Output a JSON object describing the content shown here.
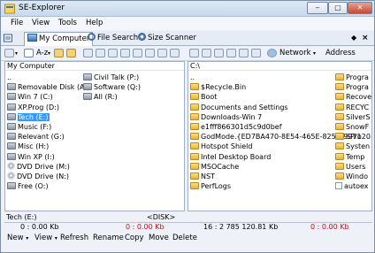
{
  "window": {
    "title": "SE-Explorer"
  },
  "menu": [
    "File",
    "View",
    "Tools",
    "Help"
  ],
  "tabs": [
    "My Computer",
    "File Search",
    "Size Scanner"
  ],
  "tab_controls": {
    "pin": "◆",
    "close": "×"
  },
  "toolbar": {
    "sort_label": "A-z",
    "network_label": "Network",
    "address_label": "Address"
  },
  "left_pane": {
    "header": "My Computer",
    "col1": [
      {
        "label": "..",
        "icon": "up-icon"
      },
      {
        "label": "Removable Disk (A:)",
        "icon": "drive-icon"
      },
      {
        "label": "Win 7 (C:)",
        "icon": "drive-icon"
      },
      {
        "label": "XP.Prog (D:)",
        "icon": "drive-icon"
      },
      {
        "label": "Tech (E:)",
        "icon": "drive-icon",
        "selected": true
      },
      {
        "label": "Music (F:)",
        "icon": "drive-icon"
      },
      {
        "label": "Relevant (G:)",
        "icon": "drive-icon"
      },
      {
        "label": "Misc (H:)",
        "icon": "drive-icon"
      },
      {
        "label": "Win XP (I:)",
        "icon": "drive-icon"
      },
      {
        "label": "DVD Drive (M:)",
        "icon": "disk-icon"
      },
      {
        "label": "DVD Drive (N:)",
        "icon": "disk-icon"
      },
      {
        "label": "Free (O:)",
        "icon": "drive-icon"
      }
    ],
    "col2": [
      {
        "label": "Civil Talk (P:)",
        "icon": "drive-icon"
      },
      {
        "label": "Software (Q:)",
        "icon": "drive-icon"
      },
      {
        "label": "All (R:)",
        "icon": "drive-icon"
      }
    ],
    "status_name": "Tech (E:)",
    "status_type": "<DISK>",
    "free_label": "0 : 0.00 Kb",
    "size_label": "0 : 0.00 Kb"
  },
  "right_pane": {
    "header": "C:\\",
    "col1": [
      {
        "label": "..",
        "icon": "up-icon"
      },
      {
        "label": "$Recycle.Bin",
        "icon": "folder-icon"
      },
      {
        "label": "Boot",
        "icon": "folder-icon"
      },
      {
        "label": "Documents and Settings",
        "icon": "folder-icon"
      },
      {
        "label": "Downloads-Win 7",
        "icon": "folder-icon"
      },
      {
        "label": "e1fff866301d5c9d0bef",
        "icon": "folder-icon"
      },
      {
        "label": "GodMode.{ED7BA470-8E54-465E-825C-9971",
        "icon": "folder-icon"
      },
      {
        "label": "Hotspot Shield",
        "icon": "folder-icon"
      },
      {
        "label": "Intel Desktop Board",
        "icon": "folder-icon"
      },
      {
        "label": "MSOCache",
        "icon": "folder-icon"
      },
      {
        "label": "NST",
        "icon": "folder-icon"
      },
      {
        "label": "PerfLogs",
        "icon": "folder-icon"
      }
    ],
    "col2": [
      {
        "label": "Progra",
        "icon": "folder-icon"
      },
      {
        "label": "Progra",
        "icon": "folder-icon"
      },
      {
        "label": "Recove",
        "icon": "folder-icon"
      },
      {
        "label": "RECYC",
        "icon": "folder-icon"
      },
      {
        "label": "SilverS",
        "icon": "folder-icon"
      },
      {
        "label": "SnowF",
        "icon": "folder-icon"
      },
      {
        "label": "SPro20",
        "icon": "folder-icon"
      },
      {
        "label": "Systen",
        "icon": "folder-icon"
      },
      {
        "label": "Temp",
        "icon": "folder-icon"
      },
      {
        "label": "Users",
        "icon": "folder-icon"
      },
      {
        "label": "Windo",
        "icon": "folder-icon"
      },
      {
        "label": "autoex",
        "icon": "file-icon"
      }
    ],
    "free_label": "16 : 2 785 120.81 Kb",
    "size_label": "0 : 0.00 Kb"
  },
  "commands": [
    {
      "label": "New",
      "arrow": "▾"
    },
    {
      "label": "View",
      "arrow": "▾"
    },
    {
      "label": "Refresh",
      "arrow": ""
    },
    {
      "label": "Rename",
      "arrow": ""
    },
    {
      "label": "Copy",
      "arrow": ""
    },
    {
      "label": "Move",
      "arrow": ""
    },
    {
      "label": "Delete",
      "arrow": ""
    }
  ]
}
